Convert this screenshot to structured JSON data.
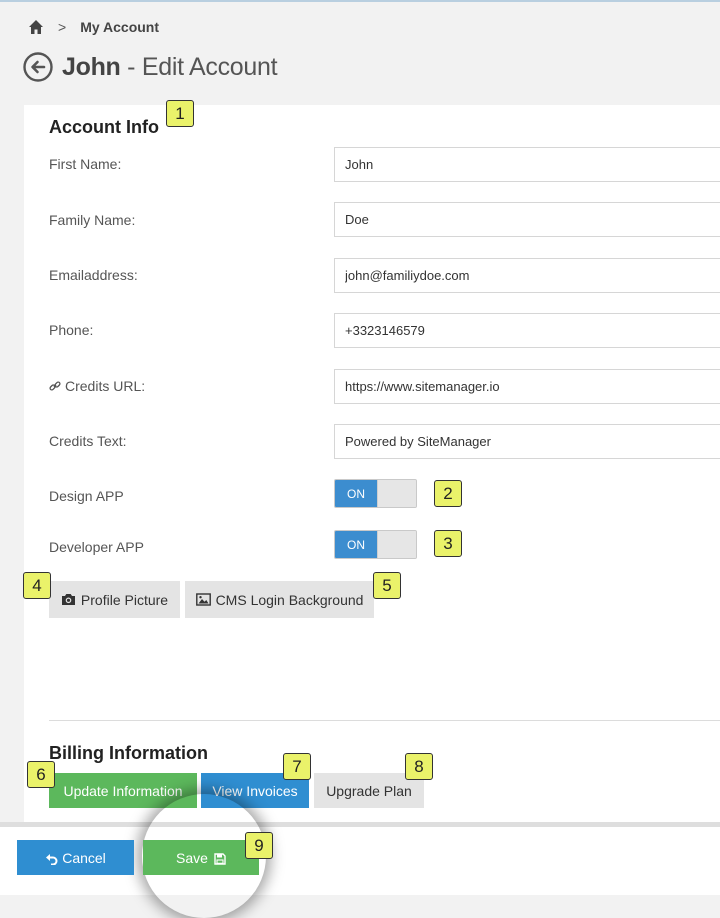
{
  "breadcrumb": {
    "separator": ">",
    "current": "My Account"
  },
  "page": {
    "name": "John",
    "subtitle": " - Edit Account"
  },
  "account_info": {
    "title": "Account Info",
    "fields": [
      {
        "label": "First Name:",
        "value": "John"
      },
      {
        "label": "Family Name:",
        "value": "Doe"
      },
      {
        "label": "Emailaddress:",
        "value": "john@familiydoe.com"
      },
      {
        "label": "Phone:",
        "value": "+3323146579"
      },
      {
        "label": "Credits URL:",
        "value": "https://www.sitemanager.io",
        "icon": "link-icon"
      },
      {
        "label": "Credits Text:",
        "value": "Powered by SiteManager"
      }
    ],
    "toggles": [
      {
        "label": "Design APP",
        "state": "ON"
      },
      {
        "label": "Developer APP",
        "state": "ON"
      }
    ],
    "buttons": {
      "profile_picture": "Profile Picture",
      "cms_login_background": "CMS Login Background"
    }
  },
  "billing": {
    "title": "Billing Information",
    "update": "Update Information",
    "invoices": "View Invoices",
    "upgrade": "Upgrade Plan"
  },
  "footer": {
    "cancel": "Cancel",
    "save": "Save"
  },
  "badges": [
    "1",
    "2",
    "3",
    "4",
    "5",
    "6",
    "7",
    "8",
    "9"
  ],
  "colors": {
    "primary": "#2f8ed1",
    "success": "#5cb85c",
    "toggle_on": "#3c8dcf",
    "badge": "#eaf26a"
  }
}
